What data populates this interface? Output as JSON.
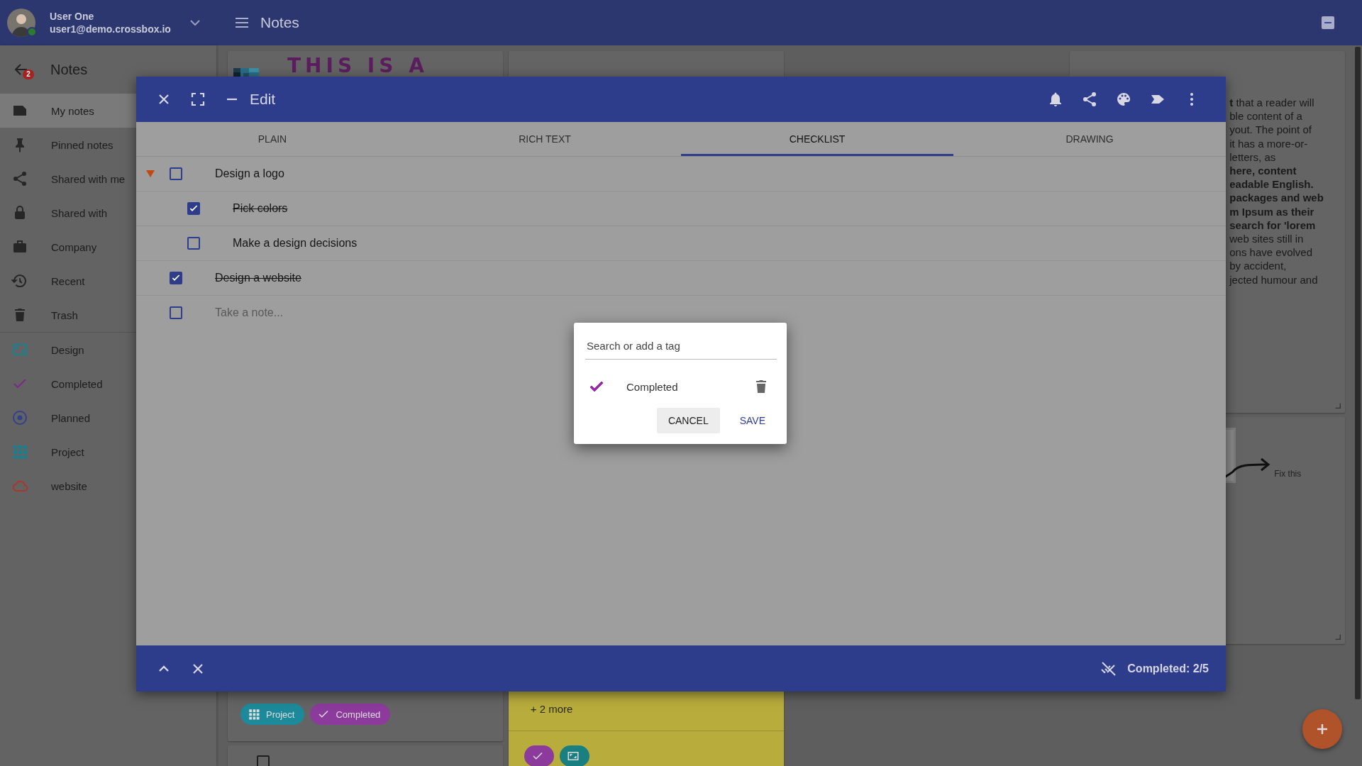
{
  "topbar": {
    "user_name": "User One",
    "user_email": "user1@demo.crossbox.io",
    "online": true,
    "title": "Notes"
  },
  "sidebar": {
    "title": "Notes",
    "badge": "2",
    "items": [
      {
        "label": "My notes",
        "kind": "note",
        "selected": true
      },
      {
        "label": "Pinned notes",
        "kind": "pin",
        "selected": false
      },
      {
        "label": "Shared with me",
        "kind": "share",
        "selected": false
      },
      {
        "label": "Shared with",
        "kind": "lock",
        "selected": false
      },
      {
        "label": "Company",
        "kind": "briefcase",
        "selected": false
      },
      {
        "label": "Recent",
        "kind": "history",
        "selected": false
      },
      {
        "label": "Trash",
        "kind": "trash",
        "selected": false
      },
      {
        "label": "Design",
        "kind": "frame",
        "color": "#16808e",
        "selected": false
      },
      {
        "label": "Completed",
        "kind": "check",
        "color": "#7b2a8a",
        "selected": false
      },
      {
        "label": "Planned",
        "kind": "target",
        "color": "#34408c",
        "selected": false
      },
      {
        "label": "Project",
        "kind": "grid",
        "color": "#16808e",
        "selected": false
      },
      {
        "label": "website",
        "kind": "cloud",
        "color": "#a8382e",
        "selected": false
      }
    ]
  },
  "notes": {
    "drawing_text": "THIS IS A",
    "tags": [
      {
        "label": "Project",
        "kind": "grid",
        "color": "#1c8a9a"
      },
      {
        "label": "Completed",
        "kind": "check",
        "color": "#8c3a9c"
      }
    ],
    "checklist_note": {
      "checked": false
    },
    "yellow_note": {
      "more": "+ 2 more",
      "tags": [
        {
          "kind": "check",
          "color": "#8c3a9c"
        },
        {
          "kind": "frame",
          "color": "#1a7f80"
        }
      ]
    },
    "text_lines": [
      {
        "text": "**t** that a reader will",
        "bold": false
      },
      {
        "text": "ble content of a",
        "bold": false
      },
      {
        "text": "yout. The point of",
        "bold": false
      },
      {
        "text": "it has a more-or-",
        "bold": false
      },
      {
        "text": "letters, as",
        "bold": false
      },
      {
        "text": "here, content",
        "bold": true
      },
      {
        "text": "eadable English.",
        "bold": true
      },
      {
        "text": "packages and web",
        "bold": true
      },
      {
        "text": "m Ipsum as their",
        "bold": true
      },
      {
        "text": "search for 'lorem",
        "bold": true
      },
      {
        "text": "web sites still in",
        "bold": false
      },
      {
        "text": "ons have evolved",
        "bold": false
      },
      {
        "text": "by accident,",
        "bold": false
      },
      {
        "text": "jected humour and",
        "bold": false
      }
    ],
    "sketch_label": "Fix this"
  },
  "editor": {
    "title": "Edit",
    "tabs": [
      {
        "label": "PLAIN",
        "selected": false
      },
      {
        "label": "RICH TEXT",
        "selected": false
      },
      {
        "label": "CHECKLIST",
        "selected": true
      },
      {
        "label": "DRAWING",
        "selected": false
      }
    ],
    "items": [
      {
        "text": "Design a logo",
        "checked": false,
        "expanded": true,
        "children": [
          {
            "text": "Pick colors",
            "checked": true
          },
          {
            "text": "Make a design decisions",
            "checked": false
          }
        ]
      },
      {
        "text": "Design a website",
        "checked": true
      }
    ],
    "new_item": {
      "placeholder": "Take a note...",
      "checked": false
    },
    "footer": {
      "status": "Completed: 2/5"
    }
  },
  "tag_dialog": {
    "search": {
      "placeholder": "Search or add a tag"
    },
    "tags": [
      {
        "label": "Completed",
        "checked": true,
        "color": "#9c27b0"
      }
    ],
    "buttons": [
      {
        "label": "CANCEL",
        "kind": "flat"
      },
      {
        "label": "SAVE",
        "kind": "primary"
      }
    ]
  }
}
